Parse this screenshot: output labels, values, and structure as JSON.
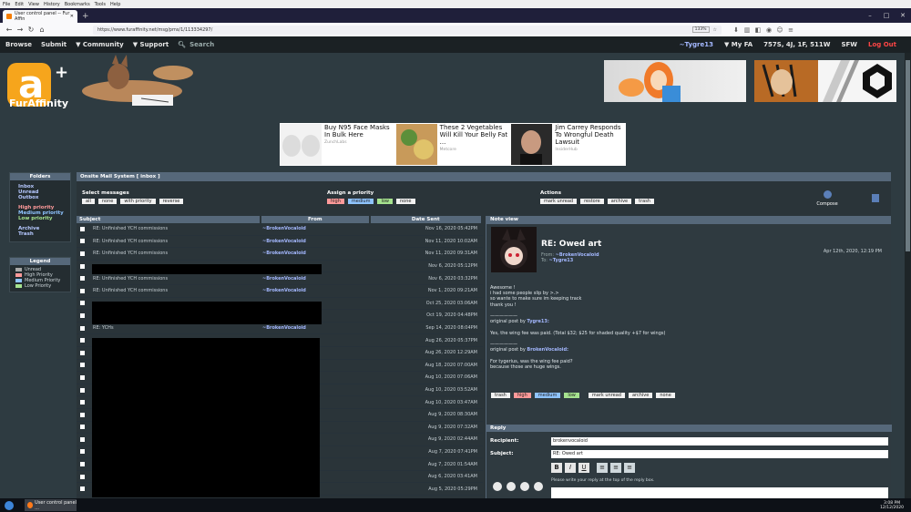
{
  "browser": {
    "menu": [
      "File",
      "Edit",
      "View",
      "History",
      "Bookmarks",
      "Tools",
      "Help"
    ],
    "tab_title": "User control panel -- Fur Affin",
    "url": "https://www.furaffinity.net/msg/pms/1/113334297/",
    "zoom": "133%"
  },
  "fa_nav": {
    "browse": "Browse",
    "submit": "Submit",
    "community": "▼ Community",
    "support": "▼ Support",
    "search": "Search",
    "user": "~Tygre13",
    "myfa": "▼ My FA",
    "stats": "757S, 4J, 1F, 511W",
    "sfw": "SFW",
    "logout": "Log Out"
  },
  "logo_text": "FurAffinity",
  "ads": [
    {
      "title": "Buy N95 Face Masks In Bulk Here",
      "source": "ZunchLabs"
    },
    {
      "title": "These 2 Vegetables Will Kill Your Belly Fat ...",
      "source": "Metcore"
    },
    {
      "title": "Jim Carrey Responds To Wrongful Death Lawsuit",
      "source": "InsiderHub"
    }
  ],
  "folders": {
    "title": "Folders",
    "items": [
      "Inbox",
      "Unread",
      "Outbox"
    ],
    "priority": [
      "High priority",
      "Medium priority",
      "Low priority"
    ],
    "other": [
      "Archive",
      "Trash"
    ]
  },
  "legend": {
    "title": "Legend",
    "items": [
      "Unread",
      "High Priority",
      "Medium Priority",
      "Low Priority"
    ]
  },
  "main": {
    "title": "Onsite Mail System [ inbox ]",
    "select_label": "Select messages",
    "select_buttons": [
      "all",
      "none",
      "with priority",
      "reverse"
    ],
    "assign_label": "Assign a priority",
    "assign_buttons": [
      "high",
      "medium",
      "low",
      "none"
    ],
    "actions_label": "Actions",
    "action_buttons": [
      "mark unread",
      "restore",
      "archive",
      "trash"
    ],
    "compose": "Compose"
  },
  "list": {
    "headers": [
      "Subject",
      "From",
      "Date Sent"
    ],
    "rows": [
      {
        "subject": "RE: Unfinished YCH commissions",
        "from": "~BrokenVocaloid",
        "date": "Nov 16, 2020 05:42PM"
      },
      {
        "subject": "RE: Unfinished YCH commissions",
        "from": "~BrokenVocaloid",
        "date": "Nov 11, 2020 10:02AM"
      },
      {
        "subject": "RE: Unfinished YCH commissions",
        "from": "~BrokenVocaloid",
        "date": "Nov 11, 2020 09:31AM"
      },
      {
        "subject": "",
        "from": "",
        "date": "Nov 6, 2020 05:12PM"
      },
      {
        "subject": "RE: Unfinished YCH commissions",
        "from": "~BrokenVocaloid",
        "date": "Nov 6, 2020 03:32PM"
      },
      {
        "subject": "RE: Unfinished YCH commissions",
        "from": "~BrokenVocaloid",
        "date": "Nov 1, 2020 09:21AM"
      },
      {
        "subject": "",
        "from": "",
        "date": "Oct 25, 2020 03:06AM"
      },
      {
        "subject": "",
        "from": "",
        "date": "Oct 19, 2020 04:48PM"
      },
      {
        "subject": "RE: YCHs",
        "from": "~BrokenVocaloid",
        "date": "Sep 14, 2020 08:04PM"
      },
      {
        "subject": "",
        "from": "",
        "date": "Aug 26, 2020 05:37PM"
      },
      {
        "subject": "",
        "from": "",
        "date": "Aug 26, 2020 12:29AM"
      },
      {
        "subject": "",
        "from": "",
        "date": "Aug 18, 2020 07:00AM"
      },
      {
        "subject": "",
        "from": "",
        "date": "Aug 10, 2020 07:06AM"
      },
      {
        "subject": "",
        "from": "",
        "date": "Aug 10, 2020 03:52AM"
      },
      {
        "subject": "",
        "from": "",
        "date": "Aug 10, 2020 03:47AM"
      },
      {
        "subject": "",
        "from": "",
        "date": "Aug 9, 2020 08:30AM"
      },
      {
        "subject": "",
        "from": "",
        "date": "Aug 9, 2020 07:32AM"
      },
      {
        "subject": "",
        "from": "",
        "date": "Aug 9, 2020 02:44AM"
      },
      {
        "subject": "",
        "from": "",
        "date": "Aug 7, 2020 07:41PM"
      },
      {
        "subject": "",
        "from": "",
        "date": "Aug 7, 2020 01:54AM"
      },
      {
        "subject": "",
        "from": "",
        "date": "Aug 6, 2020 03:41AM"
      },
      {
        "subject": "",
        "from": "",
        "date": "Aug 5, 2020 05:29PM"
      }
    ]
  },
  "note": {
    "header": "Note view",
    "title": "RE: Owed art",
    "from_label": "From:",
    "from": "~BrokenVocaloid",
    "to_label": "To:",
    "to": "~Tygre13",
    "date": "Apr 12th, 2020, 12:19 PM",
    "body_1": "Awesome !\ni had some people slip by >.>\nso wante to make sure im keeping track\nthank you !",
    "sep_1": "——————",
    "quote_1_label": "original post by ",
    "quote_1_user": "Tygre13:",
    "quote_1_text": "Yes, the wing fee was paid. (Total $32; $25 for shaded quality +$7 for wings)",
    "sep_2": "——————",
    "quote_2_label": "original post by ",
    "quote_2_user": "BrokenVocaloid:",
    "quote_2_text": "For tygerius, was the wing fee paid?\nbecause those are huge wings.",
    "buttons": [
      "trash",
      "high",
      "medium",
      "low",
      "mark unread",
      "archive",
      "none"
    ]
  },
  "reply": {
    "header": "Reply",
    "recipient_label": "Recipient:",
    "recipient": "brokenvocaloid",
    "subject_label": "Subject:",
    "subject": "RE: Owed art",
    "format": [
      "B",
      "I",
      "U"
    ],
    "hint": "Please write your reply at the top of the reply box."
  },
  "taskbar": {
    "task": "User control panel ...",
    "time": "3:08 PM",
    "date": "12/12/2020"
  }
}
